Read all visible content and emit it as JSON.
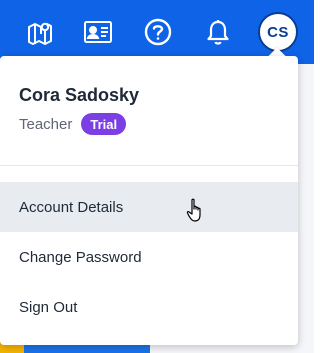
{
  "topbar": {
    "icons": [
      "map-icon",
      "id-card-icon",
      "help-icon",
      "bell-icon"
    ],
    "avatar_initials": "CS",
    "color": "#0f63e6"
  },
  "menu": {
    "user_name": "Cora Sadosky",
    "role": "Teacher",
    "badge": "Trial",
    "badge_color": "#7b3fe4",
    "items": [
      {
        "label": "Account Details",
        "hovered": true
      },
      {
        "label": "Change Password",
        "hovered": false
      },
      {
        "label": "Sign Out",
        "hovered": false
      }
    ]
  }
}
